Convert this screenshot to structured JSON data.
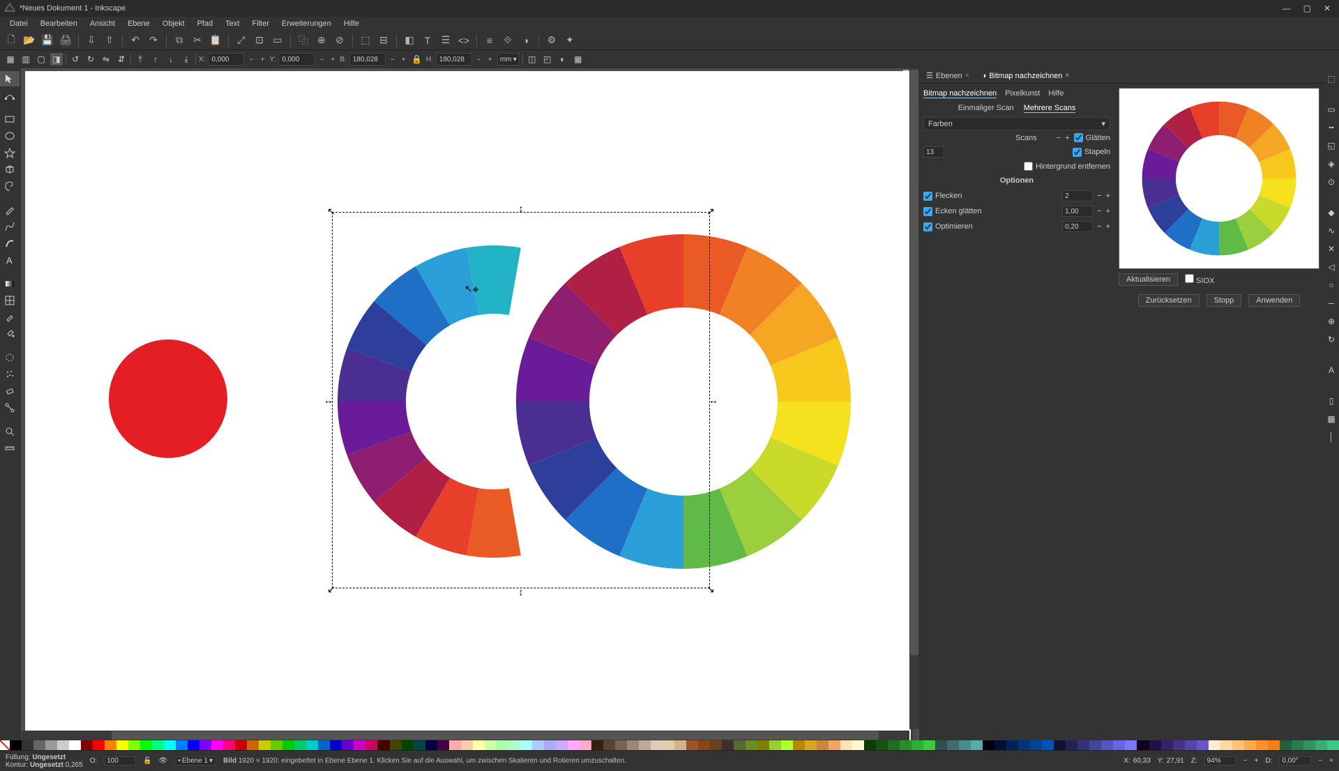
{
  "window": {
    "title": "*Neues Dokument 1 - Inkscape"
  },
  "menu": {
    "items": [
      "Datei",
      "Bearbeiten",
      "Ansicht",
      "Ebene",
      "Objekt",
      "Pfad",
      "Text",
      "Filter",
      "Erweiterungen",
      "Hilfe"
    ]
  },
  "toolopts": {
    "x_label": "X:",
    "x": "0,000",
    "y_label": "Y:",
    "y": "0,000",
    "w_label": "B:",
    "w": "180,028",
    "h_label": "H:",
    "h": "180,028",
    "unit": "mm"
  },
  "panel_tabs": {
    "layers": "Ebenen",
    "trace": "Bitmap nachzeichnen"
  },
  "trace": {
    "tabs": {
      "trace": "Bitmap nachzeichnen",
      "pixel": "Pixelkunst",
      "help": "Hilfe"
    },
    "scan_single": "Einmaliger Scan",
    "scan_multi": "Mehrere Scans",
    "mode_label": "Farben",
    "scans_label": "Scans",
    "scans_value": "13",
    "smooth": "Glätten",
    "stack": "Stapeln",
    "remove_bg": "Hintergrund entfernen",
    "options_hdr": "Optionen",
    "speckles": "Flecken",
    "speckles_v": "2",
    "corners": "Ecken glätten",
    "corners_v": "1,00",
    "optimize": "Optimieren",
    "optimize_v": "0,20",
    "update": "Aktualisieren",
    "siox": "SIOX",
    "reset": "Zurücksetzen",
    "stop": "Stopp",
    "apply": "Anwenden"
  },
  "status": {
    "fill_label": "Füllung:",
    "fill_value": "Ungesetzt",
    "stroke_label": "Kontur:",
    "stroke_value": "Ungesetzt",
    "stroke_w": "0,265",
    "opacity_label": "O:",
    "opacity": "100",
    "layer": "Ebene 1",
    "obj_type": "Bild",
    "msg": "1920 × 1920: eingebettet in Ebene Ebene 1. Klicken Sie auf die Auswahl, um zwischen Skalieren und Rotieren umzuschalten.",
    "x_label": "X:",
    "x": "60,33",
    "y_label": "Y:",
    "y": "27,91",
    "z_label": "Z:",
    "z": "94%",
    "d_label": "D:",
    "d": "0,00°"
  },
  "colors": {
    "wheel": [
      "#e83f2a",
      "#ea5a24",
      "#f08225",
      "#f5a623",
      "#f8c81c",
      "#f5e11d",
      "#c9da2a",
      "#9bcf3e",
      "#5fbb46",
      "#2a9fd8",
      "#1f6fc7",
      "#2e3f9b",
      "#4b2e91",
      "#6a1b9a",
      "#8e1e6f",
      "#b02045"
    ],
    "red": "#e31e24"
  },
  "swatches": [
    "#000",
    "#333",
    "#666",
    "#999",
    "#ccc",
    "#fff",
    "#800000",
    "#ff0000",
    "#ff8000",
    "#ffff00",
    "#80ff00",
    "#00ff00",
    "#00ff80",
    "#00ffff",
    "#0080ff",
    "#0000ff",
    "#8000ff",
    "#ff00ff",
    "#ff0080",
    "#c00",
    "#c60",
    "#cc0",
    "#6c0",
    "#0c0",
    "#0c6",
    "#0cc",
    "#06c",
    "#00c",
    "#60c",
    "#c0c",
    "#c06",
    "#400",
    "#440",
    "#040",
    "#044",
    "#004",
    "#404",
    "#faa",
    "#fca",
    "#ffa",
    "#cfa",
    "#afa",
    "#afc",
    "#aff",
    "#acf",
    "#aaf",
    "#caf",
    "#faf",
    "#fac",
    "#321",
    "#543",
    "#765",
    "#987",
    "#ba9",
    "#dcb",
    "#e0cda9",
    "#d2b48c",
    "#a0522d",
    "#8b4513",
    "#654321",
    "#3b2f2f",
    "#556b2f",
    "#6b8e23",
    "#808000",
    "#9acd32",
    "#adff2f",
    "#b8860b",
    "#daa520",
    "#cd853f",
    "#f4a460",
    "#ffe4b5",
    "#fffacd",
    "#0b3d0b",
    "#145214",
    "#1e701e",
    "#278f27",
    "#31ad31",
    "#3acb3a",
    "#2f4f4f",
    "#3c6e6e",
    "#4a8c8c",
    "#57abab",
    "#001",
    "#013",
    "#025",
    "#037",
    "#049",
    "#05b",
    "#113",
    "#225",
    "#337",
    "#449",
    "#55b",
    "#66d",
    "#77f",
    "#102",
    "#214",
    "#326",
    "#438",
    "#54a",
    "#65c",
    "#ffecd1",
    "#ffd8a8",
    "#ffc078",
    "#ffa94d",
    "#ff922b",
    "#fd7e14",
    "#206040",
    "#287a52",
    "#309363",
    "#38ad75",
    "#40c686"
  ]
}
